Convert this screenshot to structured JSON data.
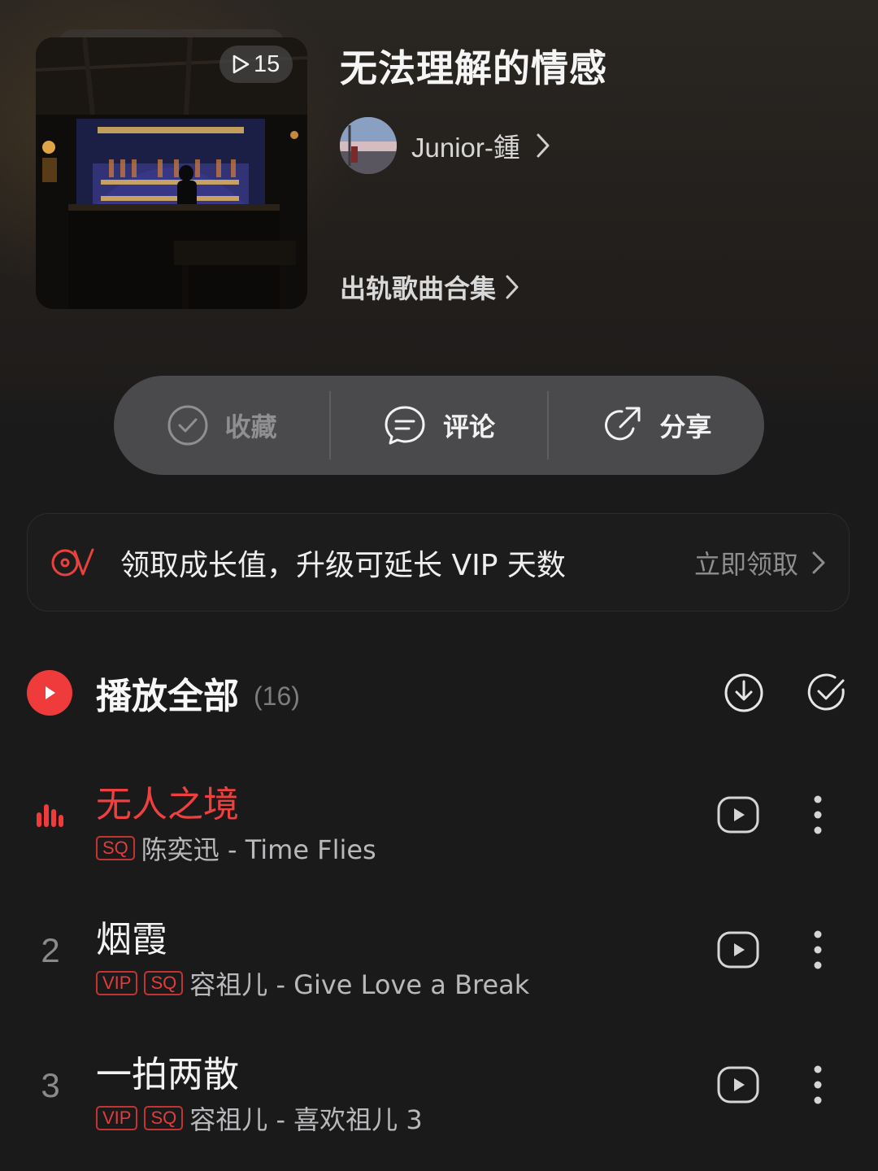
{
  "header": {
    "play_count": "15",
    "playlist_title": "无法理解的情感",
    "creator_name": "Junior-鍾",
    "collection_label": "出轨歌曲合集"
  },
  "actions": [
    {
      "label": "收藏",
      "icon": "check-circle-icon",
      "enabled": false
    },
    {
      "label": "评论",
      "icon": "comment-icon",
      "enabled": true
    },
    {
      "label": "分享",
      "icon": "share-icon",
      "enabled": true
    }
  ],
  "vip_banner": {
    "text": "领取成长值，升级可延长 VIP 天数",
    "claim_label": "立即领取"
  },
  "play_all": {
    "label": "播放全部",
    "count": "(16)"
  },
  "songs": [
    {
      "index": "",
      "playing": true,
      "title": "无人之境",
      "tags": [
        "SQ"
      ],
      "meta": "陈奕迅 - Time Flies"
    },
    {
      "index": "2",
      "playing": false,
      "title": "烟霞",
      "tags": [
        "VIP",
        "SQ"
      ],
      "meta": "容祖儿 - Give Love a Break"
    },
    {
      "index": "3",
      "playing": false,
      "title": "一拍两散",
      "tags": [
        "VIP",
        "SQ"
      ],
      "meta": "容祖儿 - 喜欢祖儿 3"
    }
  ],
  "colors": {
    "accent": "#ef3b3b",
    "background": "#1a1a1b",
    "action_bar": "#4a4a4c"
  }
}
